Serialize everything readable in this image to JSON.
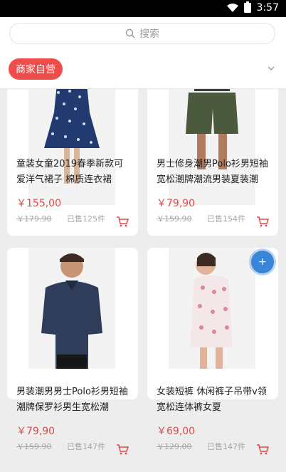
{
  "status": {
    "time": "3:57"
  },
  "search": {
    "placeholder": "搜索"
  },
  "filters": {
    "active": "商家自营"
  },
  "products": [
    {
      "title": "童装女童2019春季新款可爱洋气裙子 棉质连衣裙",
      "price": "￥155,00",
      "old_price": "￥179.90",
      "sold": "已售125件"
    },
    {
      "title": "男士修身潮男Polo衫男短袖宽松潮牌潮流男装夏装潮",
      "price": "￥79,90",
      "old_price": "￥159.90",
      "sold": "已售154件"
    },
    {
      "title": "男装潮男男士Polo衫男短袖潮牌保罗衫男生宽松潮",
      "price": "￥79,90",
      "old_price": "￥159.90",
      "sold": "已售147件"
    },
    {
      "title": "女装短裤 休闲裤子吊带v领宽松连体裤女夏",
      "price": "￥69,00",
      "old_price": "￥129.00",
      "sold": "已售147件"
    }
  ],
  "icons": {
    "status": [
      "wifi-icon",
      "battery-icon"
    ],
    "search": "search-icon",
    "filter": "chevron-down-icon",
    "cart": "cart-icon",
    "floating": "plus-icon"
  }
}
